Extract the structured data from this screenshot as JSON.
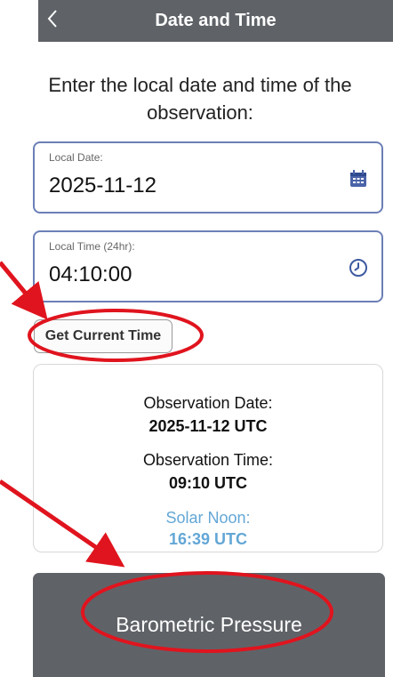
{
  "header": {
    "title": "Date and Time",
    "back_glyph": "<"
  },
  "prompt": "Enter the local date and time of the observation:",
  "date_field": {
    "label": "Local Date:",
    "value": "2025-11-12",
    "icon": "calendar-icon"
  },
  "time_field": {
    "label": "Local Time (24hr):",
    "value": "04:10:00",
    "icon": "clock-icon"
  },
  "get_current_time_label": "Get Current Time",
  "summary": {
    "date_label": "Observation Date:",
    "date_value": "2025-11-12 UTC",
    "time_label": "Observation Time:",
    "time_value": "09:10 UTC",
    "solar_label": "Solar Noon:",
    "solar_value": "16:39 UTC"
  },
  "next_button_label": "Barometric Pressure",
  "colors": {
    "header": "#5f6368",
    "accent_blue": "#63a7d6",
    "field_border": "#6c7fb6",
    "annotation_red": "#e0141e"
  }
}
